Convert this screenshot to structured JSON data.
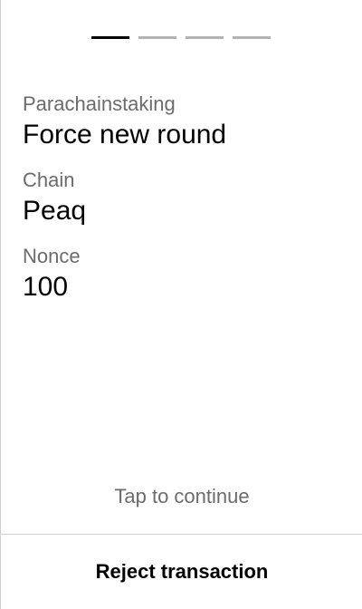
{
  "progress": {
    "total_steps": 4,
    "active_step": 1
  },
  "call": {
    "pallet_label": "Parachainstaking",
    "method": "Force new round"
  },
  "fields": [
    {
      "label": "Chain",
      "value": "Peaq"
    },
    {
      "label": "Nonce",
      "value": "100"
    }
  ],
  "hint": "Tap to continue",
  "actions": {
    "reject_label": "Reject transaction"
  },
  "colors": {
    "active_step": "#000000",
    "inactive_step": "#b3b3b3",
    "label_text": "#6b6b6b",
    "value_text": "#000000",
    "divider": "#cfcfcf"
  }
}
